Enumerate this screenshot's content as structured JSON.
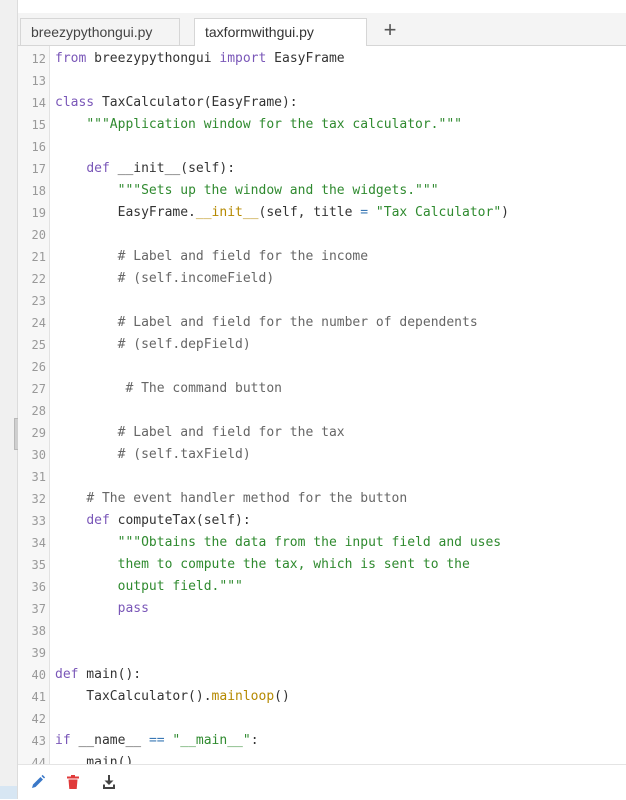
{
  "tabs": [
    {
      "label": "breezypythongui.py",
      "active": false
    },
    {
      "label": "taxformwithgui.py",
      "active": true
    }
  ],
  "add_tab_label": "+",
  "editor": {
    "lines": [
      {
        "n": "12",
        "tokens": [
          [
            "kw",
            "from"
          ],
          [
            "txt",
            " breezypythongui "
          ],
          [
            "kw",
            "import"
          ],
          [
            "txt",
            " EasyFrame"
          ]
        ]
      },
      {
        "n": "13",
        "tokens": []
      },
      {
        "n": "14",
        "tokens": [
          [
            "kw",
            "class"
          ],
          [
            "txt",
            " TaxCalculator(EasyFrame):"
          ]
        ]
      },
      {
        "n": "15",
        "tokens": [
          [
            "txt",
            "    "
          ],
          [
            "str",
            "\"\"\"Application window for the tax calculator.\"\"\""
          ]
        ]
      },
      {
        "n": "16",
        "tokens": []
      },
      {
        "n": "17",
        "tokens": [
          [
            "txt",
            "    "
          ],
          [
            "kw",
            "def"
          ],
          [
            "txt",
            " __init__(self):"
          ]
        ]
      },
      {
        "n": "18",
        "tokens": [
          [
            "txt",
            "        "
          ],
          [
            "str",
            "\"\"\"Sets up the window and the widgets.\"\"\""
          ]
        ]
      },
      {
        "n": "19",
        "tokens": [
          [
            "txt",
            "        EasyFrame."
          ],
          [
            "fn",
            "__init__"
          ],
          [
            "txt",
            "(self, title "
          ],
          [
            "op",
            "="
          ],
          [
            "txt",
            " "
          ],
          [
            "str",
            "\"Tax Calculator\""
          ],
          [
            "txt",
            ")"
          ]
        ]
      },
      {
        "n": "20",
        "tokens": []
      },
      {
        "n": "21",
        "tokens": [
          [
            "txt",
            "        "
          ],
          [
            "com",
            "# Label and field for the income"
          ]
        ]
      },
      {
        "n": "22",
        "tokens": [
          [
            "txt",
            "        "
          ],
          [
            "com",
            "# (self.incomeField)"
          ]
        ]
      },
      {
        "n": "23",
        "tokens": []
      },
      {
        "n": "24",
        "tokens": [
          [
            "txt",
            "        "
          ],
          [
            "com",
            "# Label and field for the number of dependents"
          ]
        ]
      },
      {
        "n": "25",
        "tokens": [
          [
            "txt",
            "        "
          ],
          [
            "com",
            "# (self.depField)"
          ]
        ]
      },
      {
        "n": "26",
        "tokens": []
      },
      {
        "n": "27",
        "tokens": [
          [
            "txt",
            "         "
          ],
          [
            "com",
            "# The command button"
          ]
        ]
      },
      {
        "n": "28",
        "tokens": []
      },
      {
        "n": "29",
        "tokens": [
          [
            "txt",
            "        "
          ],
          [
            "com",
            "# Label and field for the tax"
          ]
        ]
      },
      {
        "n": "30",
        "tokens": [
          [
            "txt",
            "        "
          ],
          [
            "com",
            "# (self.taxField)"
          ]
        ]
      },
      {
        "n": "31",
        "tokens": []
      },
      {
        "n": "32",
        "tokens": [
          [
            "txt",
            "    "
          ],
          [
            "com",
            "# The event handler method for the button"
          ]
        ]
      },
      {
        "n": "33",
        "tokens": [
          [
            "txt",
            "    "
          ],
          [
            "kw",
            "def"
          ],
          [
            "txt",
            " computeTax(self):"
          ]
        ]
      },
      {
        "n": "34",
        "tokens": [
          [
            "txt",
            "        "
          ],
          [
            "str",
            "\"\"\"Obtains the data from the input field and uses"
          ]
        ]
      },
      {
        "n": "35",
        "tokens": [
          [
            "txt",
            "        "
          ],
          [
            "str",
            "them to compute the tax, which is sent to the"
          ]
        ]
      },
      {
        "n": "36",
        "tokens": [
          [
            "txt",
            "        "
          ],
          [
            "str",
            "output field.\"\"\""
          ]
        ]
      },
      {
        "n": "37",
        "tokens": [
          [
            "txt",
            "        "
          ],
          [
            "kw",
            "pass"
          ]
        ]
      },
      {
        "n": "38",
        "tokens": []
      },
      {
        "n": "39",
        "tokens": []
      },
      {
        "n": "40",
        "tokens": [
          [
            "kw",
            "def"
          ],
          [
            "txt",
            " main():"
          ]
        ]
      },
      {
        "n": "41",
        "tokens": [
          [
            "txt",
            "    TaxCalculator()."
          ],
          [
            "fn",
            "mainloop"
          ],
          [
            "txt",
            "()"
          ]
        ]
      },
      {
        "n": "42",
        "tokens": []
      },
      {
        "n": "43",
        "tokens": [
          [
            "kw",
            "if"
          ],
          [
            "txt",
            " __name__ "
          ],
          [
            "op",
            "=="
          ],
          [
            "txt",
            " "
          ],
          [
            "str",
            "\"__main__\""
          ],
          [
            "txt",
            ":"
          ]
        ]
      },
      {
        "n": "44",
        "tokens": [
          [
            "txt",
            "    main()"
          ]
        ]
      }
    ]
  },
  "toolbar": {
    "edit_icon": "pencil-icon",
    "delete_icon": "trash-icon",
    "download_icon": "download-icon"
  },
  "colors": {
    "keyword": "#7a57b8",
    "string": "#2f8a2f",
    "comment": "#666666",
    "function": "#b58900",
    "operator": "#3a78b5",
    "edit": "#3a78c8",
    "delete": "#e03a3a",
    "download": "#444444"
  }
}
